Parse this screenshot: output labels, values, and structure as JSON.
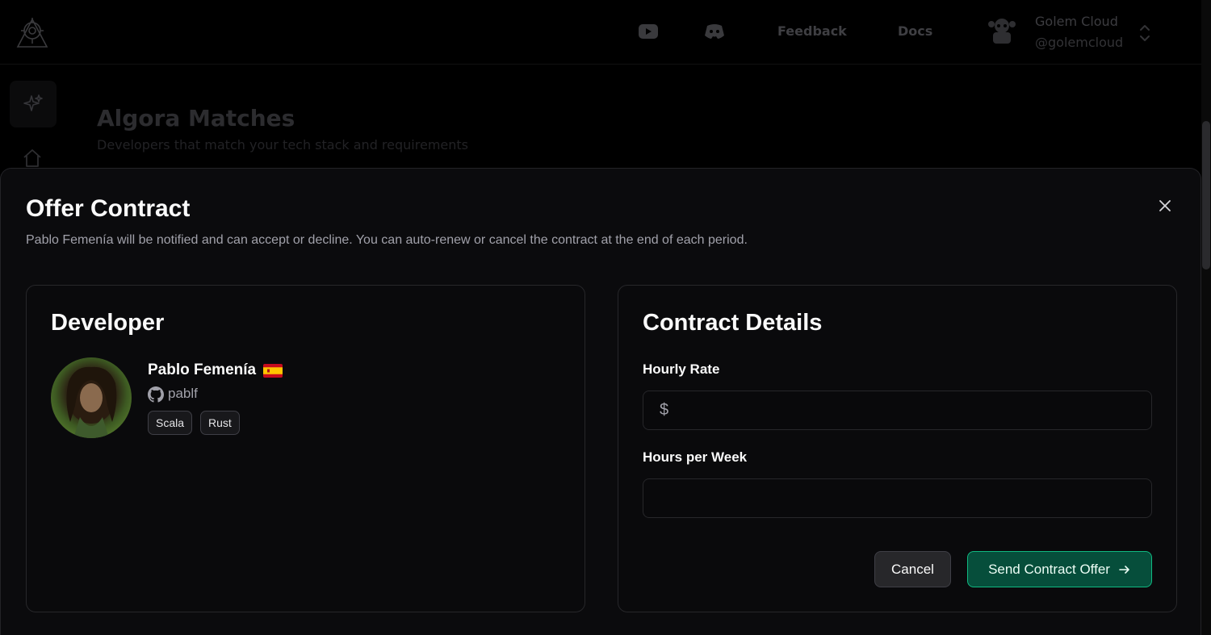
{
  "topbar": {
    "nav": {
      "feedback": "Feedback",
      "docs": "Docs"
    },
    "account": {
      "name": "Golem Cloud",
      "handle": "@golemcloud"
    }
  },
  "background": {
    "title": "Algora Matches",
    "subtitle": "Developers that match your tech stack and requirements"
  },
  "modal": {
    "title": "Offer Contract",
    "description": "Pablo Femenía will be notified and can accept or decline. You can auto-renew or cancel the contract at the end of each period.",
    "developer_panel": {
      "title": "Developer",
      "name": "Pablo Femenía",
      "flag": "Spain",
      "github_handle": "pablf",
      "tags": [
        "Scala",
        "Rust"
      ]
    },
    "contract_panel": {
      "title": "Contract Details",
      "hourly_rate": {
        "label": "Hourly Rate",
        "prefix": "$",
        "value": "",
        "placeholder": ""
      },
      "hours_per_week": {
        "label": "Hours per Week",
        "value": "",
        "placeholder": ""
      }
    },
    "actions": {
      "cancel": "Cancel",
      "send": "Send Contract Offer"
    }
  },
  "colors": {
    "modal_bg": "#0b0b0d",
    "border": "#27272a",
    "primary_green": "#064e3b",
    "primary_green_border": "#10b981",
    "muted_text": "#a1a1aa"
  }
}
